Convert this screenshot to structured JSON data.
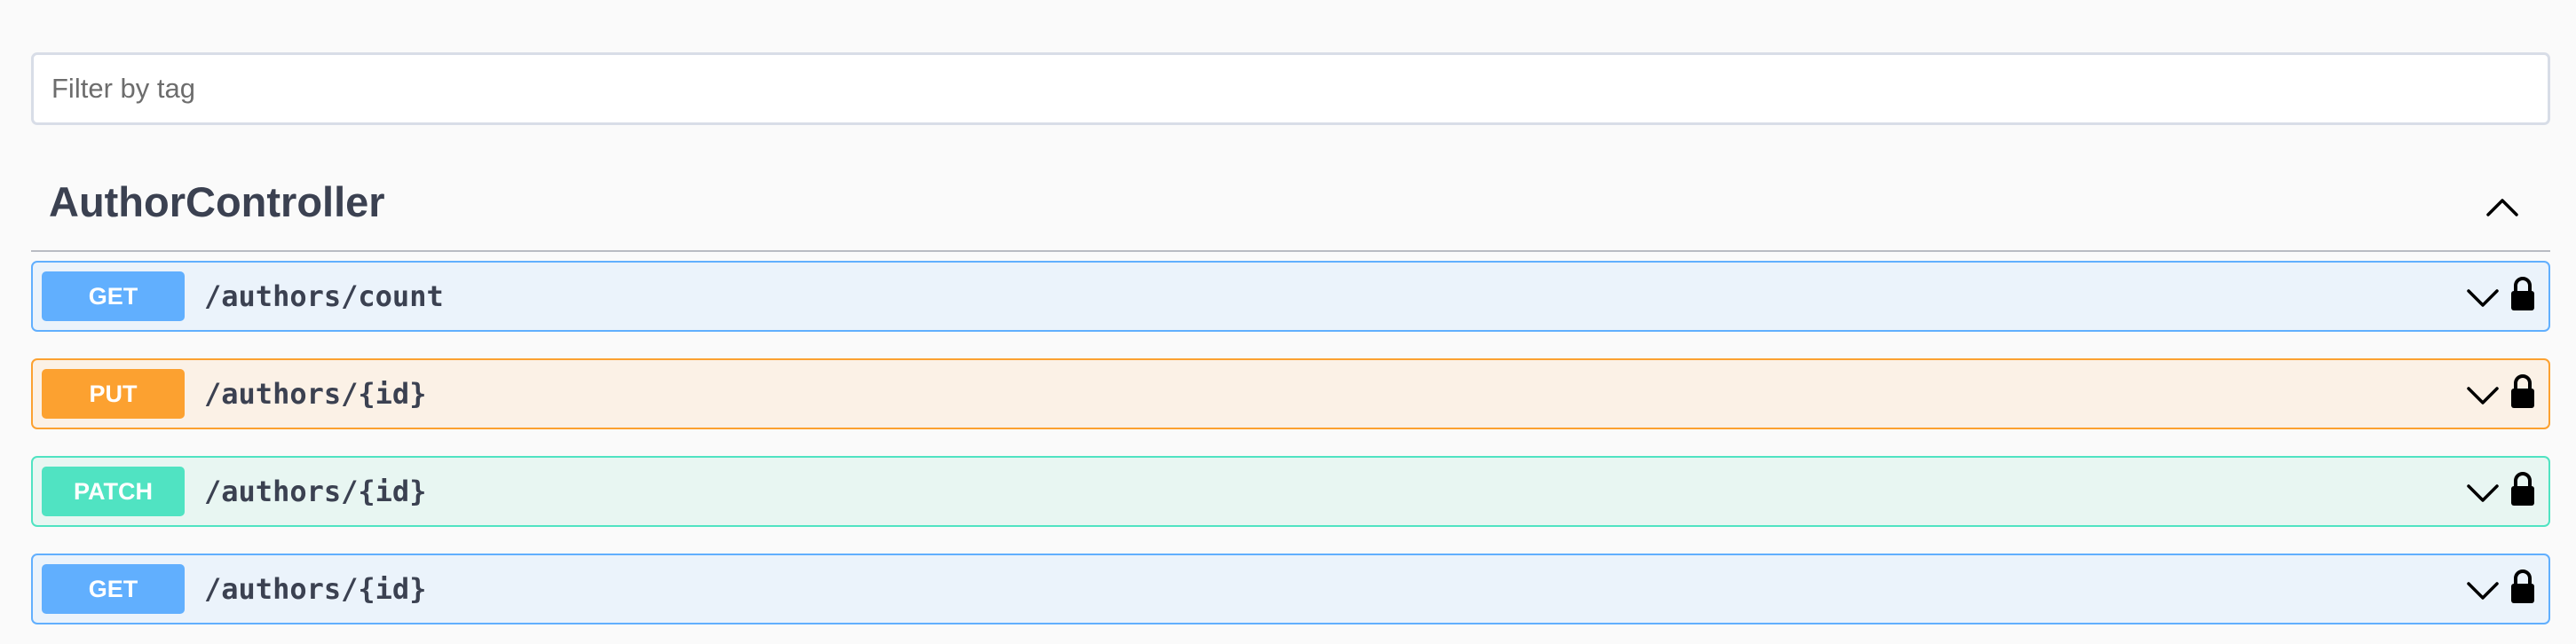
{
  "filter": {
    "placeholder": "Filter by tag",
    "value": ""
  },
  "tag": {
    "title": "AuthorController",
    "expanded": true,
    "toggle_icon": "chevron-up-icon"
  },
  "colors": {
    "get": "#61affe",
    "get_bg": "#ebf3fb",
    "put": "#fca130",
    "put_bg": "#fbf1e6",
    "patch": "#50e3c2",
    "patch_bg": "#e8f6f2",
    "text": "#3b4151"
  },
  "operations": [
    {
      "method": "GET",
      "path": "/authors/count",
      "expand_icon": "chevron-down-icon",
      "auth_icon": "lock-icon"
    },
    {
      "method": "PUT",
      "path": "/authors/{id}",
      "expand_icon": "chevron-down-icon",
      "auth_icon": "lock-icon"
    },
    {
      "method": "PATCH",
      "path": "/authors/{id}",
      "expand_icon": "chevron-down-icon",
      "auth_icon": "lock-icon"
    },
    {
      "method": "GET",
      "path": "/authors/{id}",
      "expand_icon": "chevron-down-icon",
      "auth_icon": "lock-icon"
    }
  ]
}
